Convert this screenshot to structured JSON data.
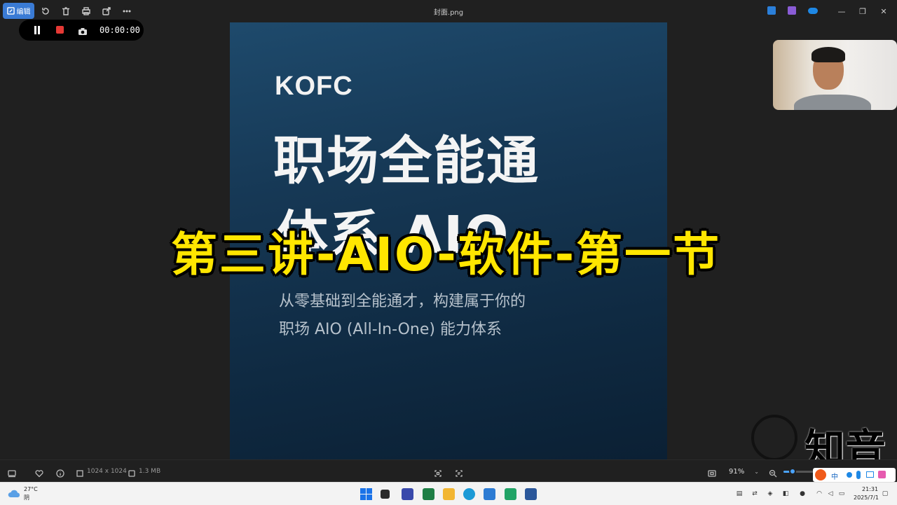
{
  "titlebar": {
    "edit_label": "编辑",
    "window_title": "封面.png",
    "window_controls": [
      "—",
      "❐",
      "✕"
    ]
  },
  "recorder": {
    "time": "00:00:00"
  },
  "image": {
    "brand": "KOFC",
    "title_line1": "职场全能通",
    "title_line2": "体系 AIO",
    "subtitle_line1": "从零基础到全能通才，构建属于你的",
    "subtitle_line2": "职场 AIO (All-In-One) 能力体系"
  },
  "overlay": {
    "text": "第三讲-AIO-软件-第一节"
  },
  "watermark": {
    "text": "知音"
  },
  "statusbar": {
    "dimensions": "1024 x 1024",
    "file_size": "1.3 MB",
    "zoom": "91%",
    "zoom_level": 0.12
  },
  "taskbar": {
    "weather_temp": "27°C",
    "weather_cond": "阴",
    "ime_label": "中",
    "clock_time": "21:31",
    "clock_date": "2025/7/1"
  },
  "colors": {
    "accent": "#3a7bd5",
    "overlay_text": "#ffe600",
    "record_stop": "#e53935"
  }
}
